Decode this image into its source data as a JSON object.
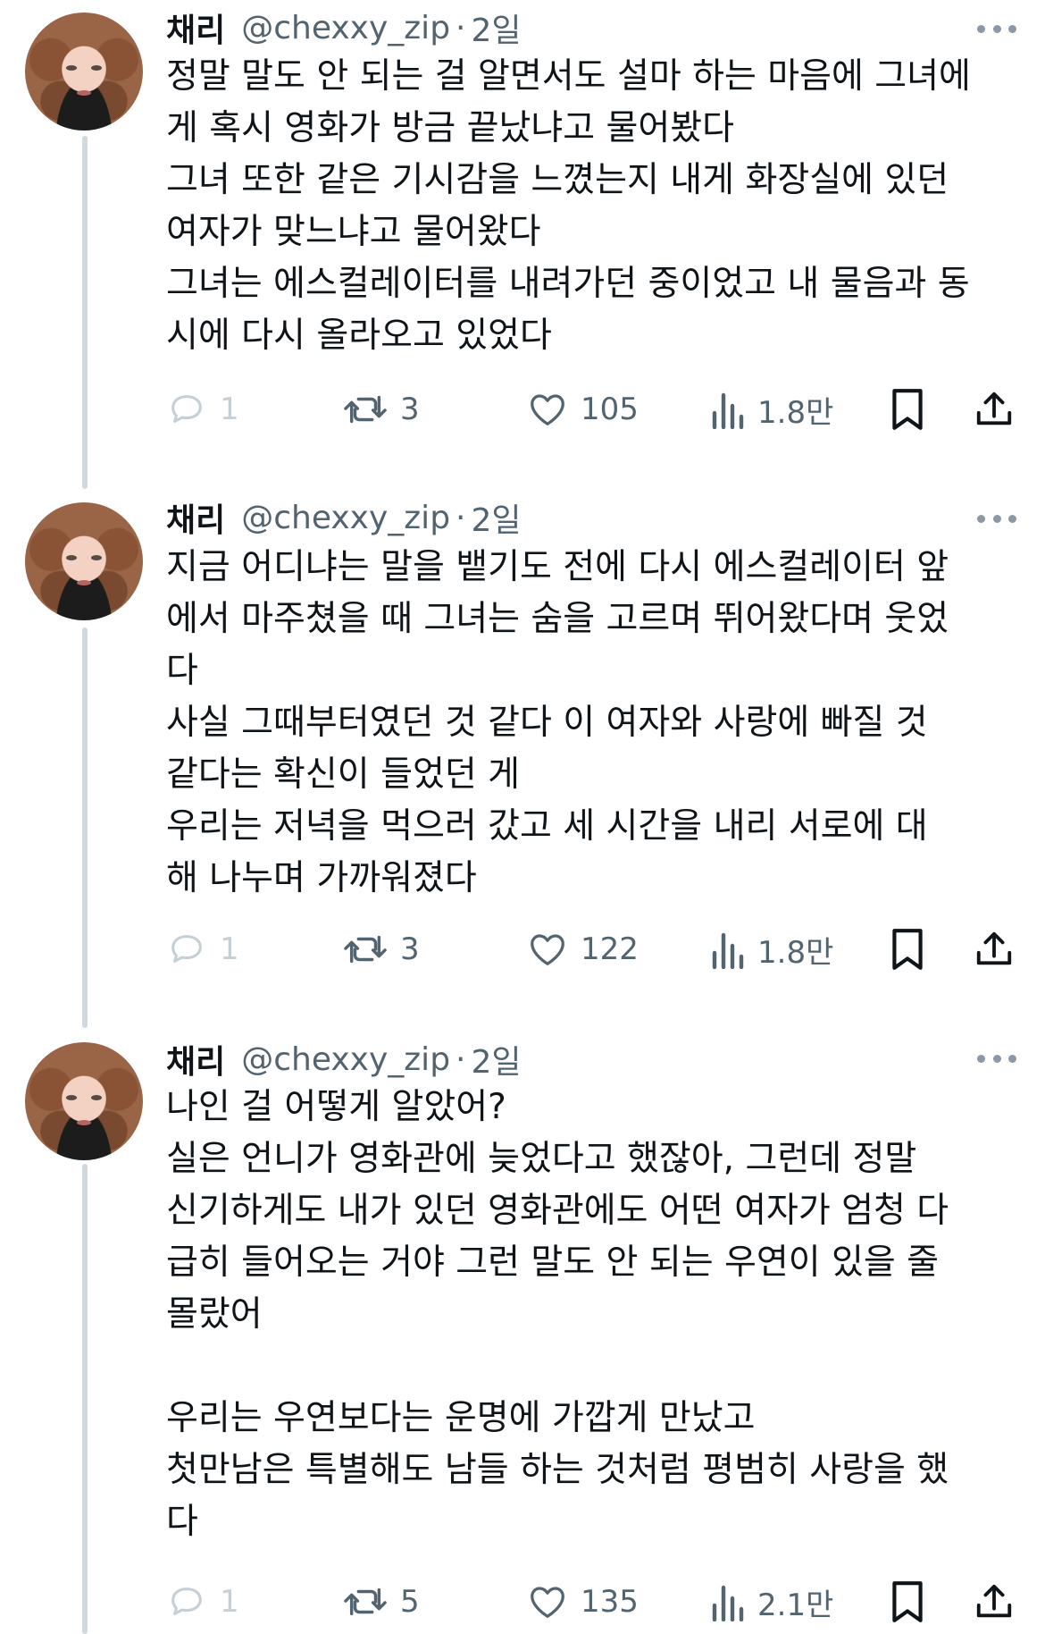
{
  "tweets": [
    {
      "author_name": "채리",
      "handle": "@chexxy_zip",
      "dot": "·",
      "time": "2일",
      "text": "정말 말도 안 되는 걸 알면서도 설마 하는 마음에 그녀에\n게 혹시 영화가 방금 끝났냐고 물어봤다\n그녀 또한 같은 기시감을 느꼈는지 내게 화장실에 있던\n여자가 맞느냐고 물어왔다\n그녀는 에스컬레이터를 내려가던 중이었고 내 물음과 동\n시에 다시 올라오고 있었다",
      "replies": "1",
      "retweets": "3",
      "likes": "105",
      "views": "1.8만"
    },
    {
      "author_name": "채리",
      "handle": "@chexxy_zip",
      "dot": "·",
      "time": "2일",
      "text": "지금 어디냐는 말을 뱉기도 전에 다시 에스컬레이터 앞\n에서 마주쳤을 때 그녀는 숨을 고르며 뛰어왔다며 웃었\n다\n사실 그때부터였던 것 같다 이 여자와 사랑에 빠질 것\n같다는 확신이 들었던 게\n우리는 저녁을 먹으러 갔고 세 시간을 내리 서로에 대\n해 나누며 가까워졌다",
      "replies": "1",
      "retweets": "3",
      "likes": "122",
      "views": "1.8만"
    },
    {
      "author_name": "채리",
      "handle": "@chexxy_zip",
      "dot": "·",
      "time": "2일",
      "text": "나인 걸 어떻게 알았어?\n실은 언니가 영화관에 늦었다고 했잖아, 그런데 정말\n신기하게도 내가 있던 영화관에도 어떤 여자가 엄청 다\n급히 들어오는 거야 그런 말도 안 되는 우연이 있을 줄\n몰랐어\n\n우리는 우연보다는 운명에 가깝게 만났고\n첫만남은 특별해도 남들 하는 것처럼 평범히 사랑을 했\n다",
      "replies": "1",
      "retweets": "5",
      "likes": "135",
      "views": "2.1만"
    }
  ],
  "colors": {
    "text": "#0f1419",
    "secondary": "#536471",
    "thread_line": "#cfd9de",
    "faded": "#c4cfd6"
  },
  "icons": [
    "avatar",
    "more-icon",
    "reply-icon",
    "retweet-icon",
    "like-icon",
    "views-icon",
    "bookmark-icon",
    "share-icon"
  ]
}
